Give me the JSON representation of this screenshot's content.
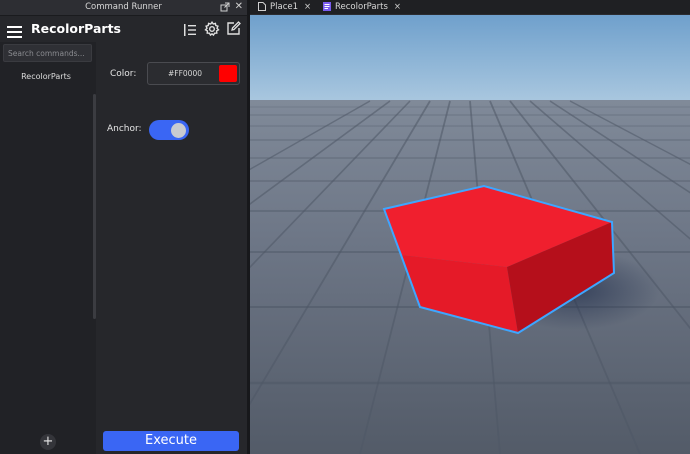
{
  "window": {
    "title": "Command Runner"
  },
  "plugin": {
    "title": "RecolorParts",
    "icons": {
      "menu": "hamburger-menu-icon",
      "list": "list-icon",
      "settings": "gear-icon",
      "edit": "edit-icon",
      "undock": "undock-icon",
      "close": "close-icon"
    }
  },
  "sidebar": {
    "search_placeholder": "Search commands...",
    "search_value": "",
    "items": [
      {
        "label": "RecolorParts"
      }
    ],
    "add_label": "+"
  },
  "panel": {
    "color_label": "Color:",
    "color_value": "#FF0000",
    "swatch_color": "#ff0000",
    "anchor_label": "Anchor:",
    "anchor_on": true,
    "execute_label": "Execute"
  },
  "tabs": [
    {
      "label": "Place1",
      "close": "×",
      "icon": "place-file-icon"
    },
    {
      "label": "RecolorParts",
      "close": "×",
      "icon": "script-icon"
    }
  ],
  "colors": {
    "accent": "#3a66f4",
    "part_red": "#ff0000",
    "selection_outline": "#3ea6ff"
  }
}
